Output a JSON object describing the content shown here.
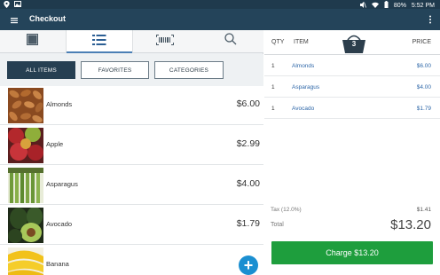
{
  "status_bar": {
    "battery": "80%",
    "time": "5:52 PM"
  },
  "app_bar": {
    "title": "Checkout"
  },
  "view_tabs": [
    {
      "icon": "grid-icon",
      "active": false
    },
    {
      "icon": "list-icon",
      "active": true
    },
    {
      "icon": "barcode-icon",
      "active": false
    },
    {
      "icon": "search-icon",
      "active": false
    }
  ],
  "filters": {
    "all_items": "ALL ITEMS",
    "favorites": "FAVORITES",
    "categories": "CATEGORIES"
  },
  "items": [
    {
      "name": "Almonds",
      "price": "$6.00"
    },
    {
      "name": "Apple",
      "price": "$2.99"
    },
    {
      "name": "Asparagus",
      "price": "$4.00"
    },
    {
      "name": "Avocado",
      "price": "$1.79"
    },
    {
      "name": "Banana",
      "price": ""
    }
  ],
  "cart": {
    "qty_header": "QTY",
    "item_header": "ITEM",
    "price_header": "PRICE",
    "count": "3",
    "rows": [
      {
        "qty": "1",
        "name": "Almonds",
        "price": "$6.00"
      },
      {
        "qty": "1",
        "name": "Asparagus",
        "price": "$4.00"
      },
      {
        "qty": "1",
        "name": "Avocado",
        "price": "$1.79"
      }
    ],
    "tax_label": "Tax (12.0%)",
    "tax_value": "$1.41",
    "total_label": "Total",
    "total_value": "$13.20",
    "charge_label": "Charge $13.20"
  },
  "colors": {
    "app_bar": "#24445a",
    "accent_blue": "#2e67a8",
    "charge_green": "#1e9e3d",
    "fab_blue": "#1b8fd1"
  }
}
